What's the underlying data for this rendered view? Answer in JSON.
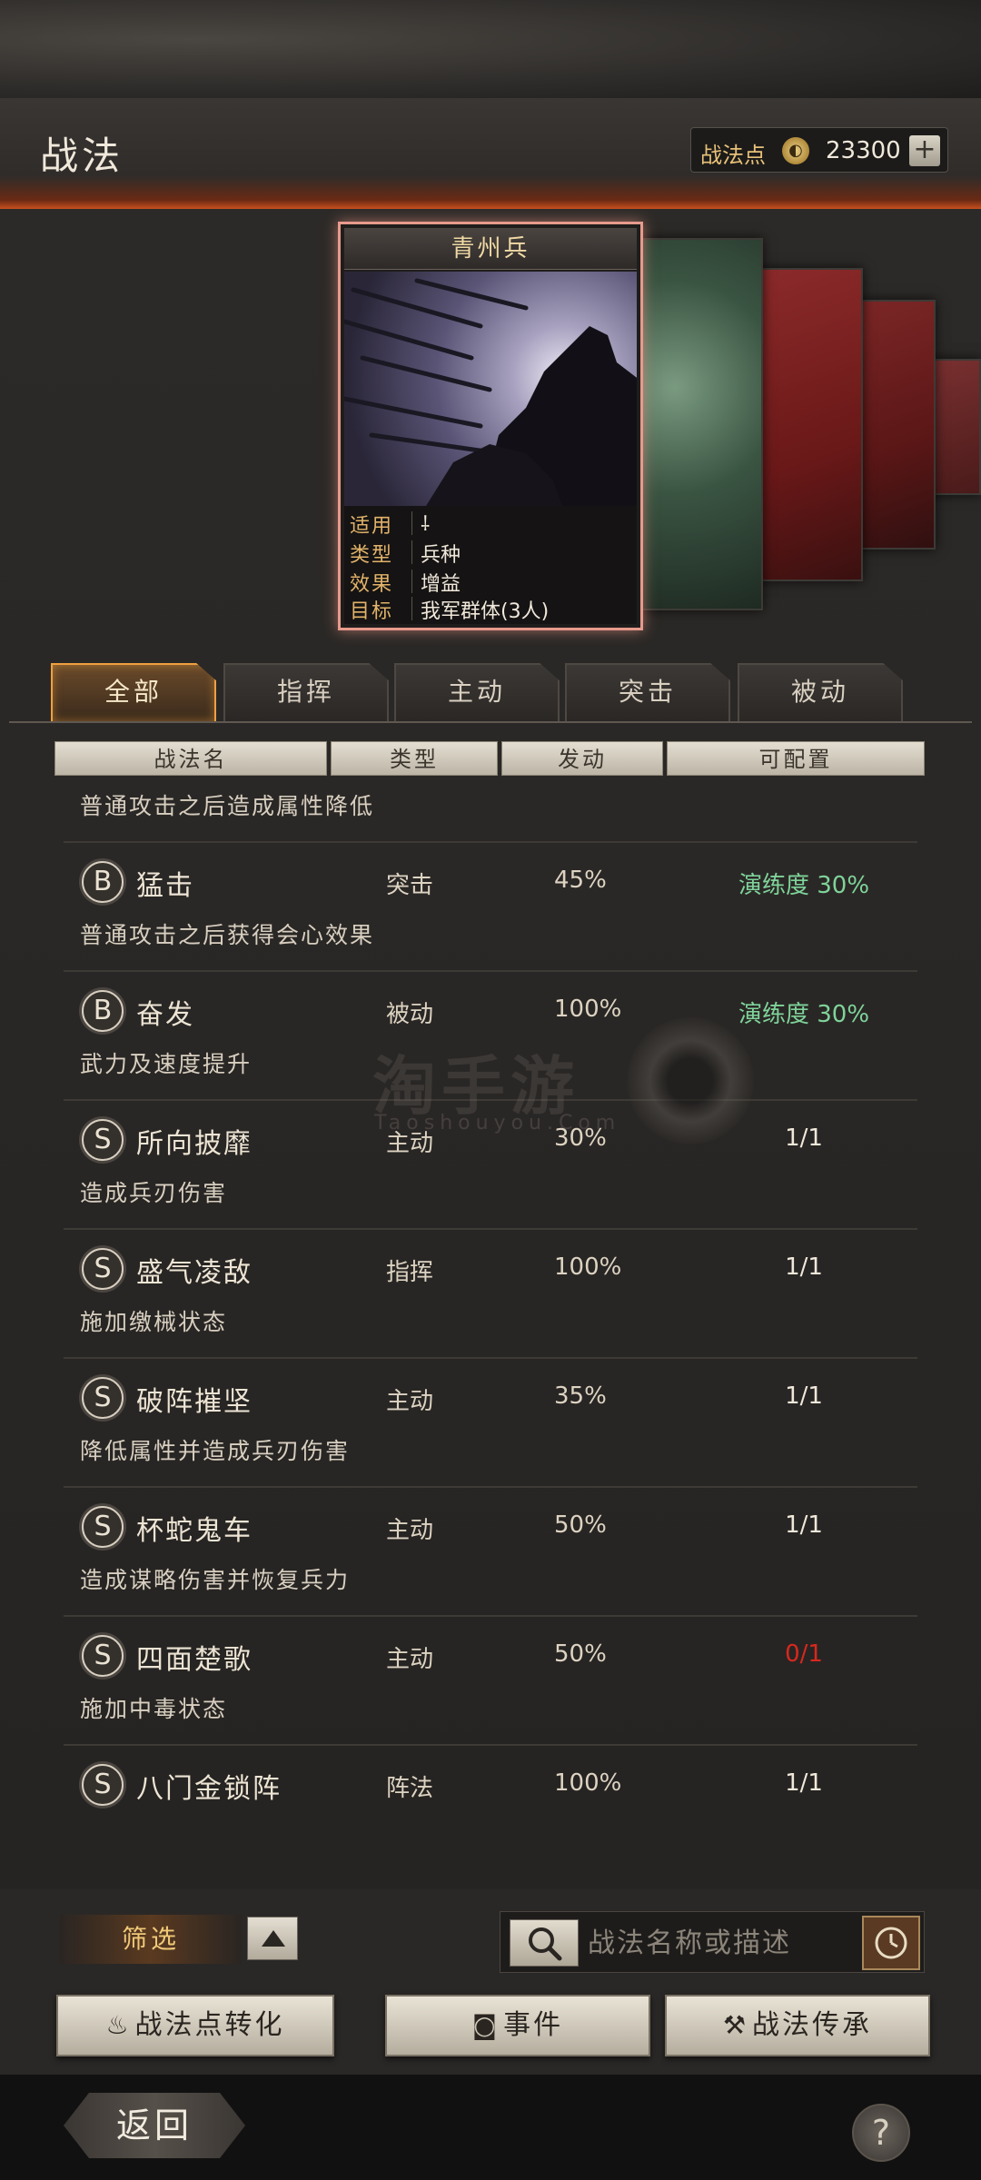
{
  "header": {
    "title": "战法",
    "points_label": "战法点",
    "points_value": "23300",
    "plus": "+"
  },
  "card": {
    "name": "青州兵",
    "fields": [
      {
        "key": "适用",
        "value": ""
      },
      {
        "key": "类型",
        "value": "兵种"
      },
      {
        "key": "效果",
        "value": "增益"
      },
      {
        "key": "目标",
        "value": "我军群体(3人)"
      }
    ]
  },
  "tabs": [
    "全部",
    "指挥",
    "主动",
    "突击",
    "被动"
  ],
  "columns": [
    "战法名",
    "类型",
    "发动",
    "可配置"
  ],
  "rows": [
    {
      "grade": "",
      "name": "",
      "type": "",
      "rate": "",
      "config": "",
      "desc": "普通攻击之后造成属性降低"
    },
    {
      "grade": "B",
      "name": "猛击",
      "type": "突击",
      "rate": "45%",
      "config": "演练度 30%",
      "desc": "普通攻击之后获得会心效果"
    },
    {
      "grade": "B",
      "name": "奋发",
      "type": "被动",
      "rate": "100%",
      "config": "演练度 30%",
      "desc": "武力及速度提升"
    },
    {
      "grade": "S",
      "name": "所向披靡",
      "type": "主动",
      "rate": "30%",
      "config": "1/1",
      "desc": "造成兵刃伤害"
    },
    {
      "grade": "S",
      "name": "盛气凌敌",
      "type": "指挥",
      "rate": "100%",
      "config": "1/1",
      "desc": "施加缴械状态"
    },
    {
      "grade": "S",
      "name": "破阵摧坚",
      "type": "主动",
      "rate": "35%",
      "config": "1/1",
      "desc": "降低属性并造成兵刃伤害"
    },
    {
      "grade": "S",
      "name": "杯蛇鬼车",
      "type": "主动",
      "rate": "50%",
      "config": "1/1",
      "desc": "造成谋略伤害并恢复兵力"
    },
    {
      "grade": "S",
      "name": "四面楚歌",
      "type": "主动",
      "rate": "50%",
      "config": "0/1",
      "desc": "施加中毒状态"
    },
    {
      "grade": "S",
      "name": "八门金锁阵",
      "type": "阵法",
      "rate": "100%",
      "config": "1/1",
      "desc": ""
    }
  ],
  "config_colors": {
    "training": "#7fd39a",
    "unavailable": "#d8281e",
    "normal": "#f0e8da"
  },
  "filter": {
    "label": "筛选"
  },
  "search": {
    "placeholder": "战法名称或描述"
  },
  "actions": {
    "convert": "战法点转化",
    "events": "事件",
    "inherit": "战法传承"
  },
  "footer": {
    "back": "返回",
    "help": "?"
  },
  "watermark": {
    "main": "淘手游",
    "sub": "Taoshouyou.Com"
  }
}
